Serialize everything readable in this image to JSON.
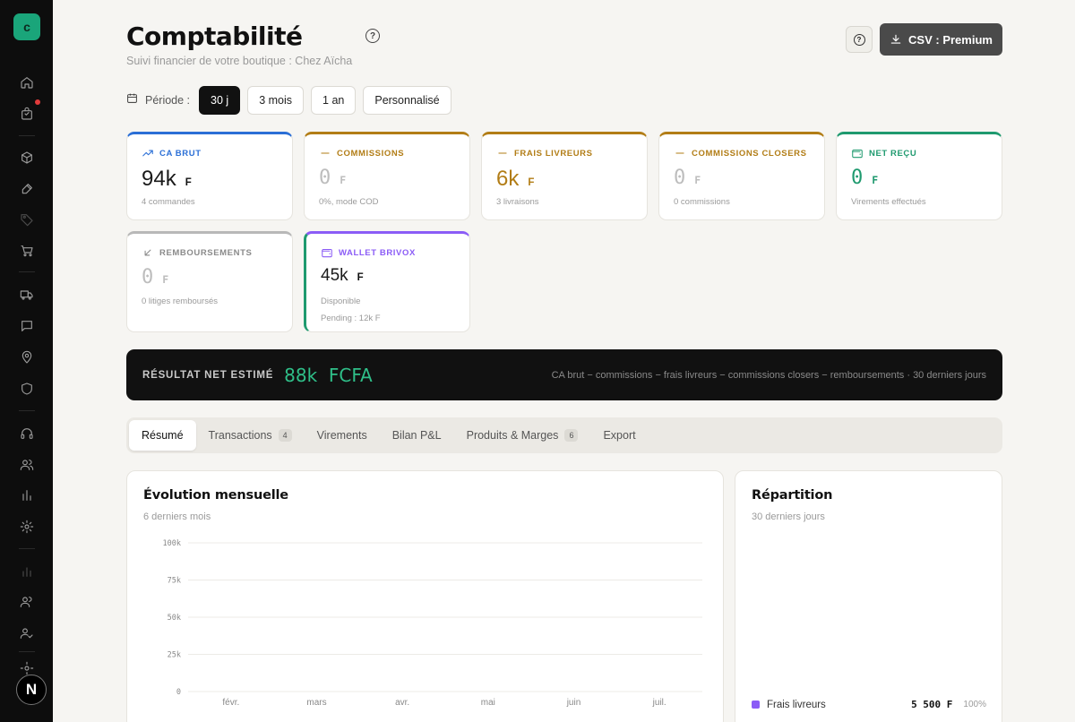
{
  "sidebar": {
    "logo_letter": "c",
    "avatar_letter": "N",
    "icons": [
      "home-icon",
      "bag-icon",
      "box-icon",
      "brush-icon",
      "tag-icon",
      "cart-icon",
      "truck-icon",
      "chat-icon",
      "location-icon",
      "shield-icon",
      "headset-icon",
      "users-icon",
      "bar-chart-icon",
      "settings-icon",
      "analytics-icon",
      "team-icon",
      "user-check-icon",
      "settings-icon"
    ]
  },
  "header": {
    "title": "Comptabilité",
    "subtitle": "Suivi financier de votre boutique : Chez Aïcha",
    "csv_label": "CSV : Premium"
  },
  "period": {
    "label": "Période :",
    "options": [
      "30 j",
      "3 mois",
      "1 an",
      "Personnalisé"
    ],
    "selected": "30 j"
  },
  "metrics": {
    "ca_brut": {
      "label": "CA BRUT",
      "value": "94k",
      "unit": "F",
      "sub": "4 commandes",
      "color": "#2b6fd6"
    },
    "commissions": {
      "label": "COMMISSIONS",
      "value": "0",
      "unit": "F",
      "sub": "0%, mode COD",
      "color": "#b27d16"
    },
    "frais_livreurs": {
      "label": "FRAIS LIVREURS",
      "value": "6k",
      "unit": "F",
      "sub": "3 livraisons",
      "color": "#b27d16"
    },
    "commissions_closers": {
      "label": "COMMISSIONS CLOSERS",
      "value": "0",
      "unit": "F",
      "sub": "0 commissions",
      "color": "#b27d16"
    },
    "net_recu": {
      "label": "NET REÇU",
      "value": "0",
      "unit": "F",
      "sub": "Virements effectués",
      "color": "#1f9a6f"
    },
    "remboursements": {
      "label": "REMBOURSEMENTS",
      "value": "0",
      "unit": "F",
      "sub": "0 litiges remboursés",
      "color": "#8a8a8a"
    },
    "wallet": {
      "label": "WALLET BRIVOX",
      "value": "45k",
      "unit": "F",
      "sub": "Disponible",
      "sub2": "Pending : 12k F",
      "color": "#8b5cf6"
    }
  },
  "net_result": {
    "label": "RÉSULTAT NET ESTIMÉ",
    "value": "88k",
    "unit": "FCFA",
    "note": "CA brut − commissions − frais livreurs − commissions closers − remboursements · 30 derniers jours"
  },
  "tabs": [
    {
      "label": "Résumé",
      "active": true
    },
    {
      "label": "Transactions",
      "badge": "4"
    },
    {
      "label": "Virements"
    },
    {
      "label": "Bilan P&L"
    },
    {
      "label": "Produits & Marges",
      "badge": "6"
    },
    {
      "label": "Export"
    }
  ],
  "evolution": {
    "title": "Évolution mensuelle",
    "subtitle": "6 derniers mois"
  },
  "repartition": {
    "title": "Répartition",
    "subtitle": "30 derniers jours",
    "legend": [
      {
        "label": "Frais livreurs",
        "value": "5 500 F",
        "pct": "100%",
        "color": "#8b5cf6"
      }
    ]
  },
  "chart_data": {
    "type": "line",
    "title": "Évolution mensuelle",
    "categories": [
      "févr.",
      "mars",
      "avr.",
      "mai",
      "juin",
      "juil."
    ],
    "y_ticks": [
      "100k",
      "75k",
      "50k",
      "25k",
      "0"
    ],
    "ylim": [
      0,
      100000
    ],
    "grid": true,
    "series": []
  }
}
